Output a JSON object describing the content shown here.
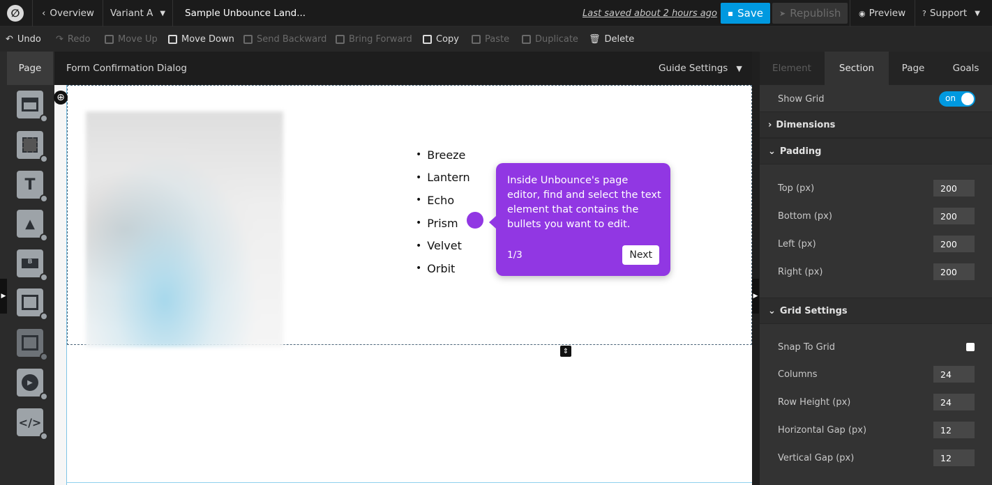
{
  "topbar": {
    "overview": "Overview",
    "variant": "Variant A",
    "page_name": "Sample Unbounce Land...",
    "last_saved": "Last saved  about 2 hours ago",
    "save": "Save",
    "republish": "Republish",
    "preview": "Preview",
    "support": "Support"
  },
  "toolbar": {
    "undo": "Undo",
    "redo": "Redo",
    "move_up": "Move Up",
    "move_down": "Move Down",
    "send_backward": "Send Backward",
    "bring_forward": "Bring Forward",
    "copy": "Copy",
    "paste": "Paste",
    "duplicate": "Duplicate",
    "delete": "Delete"
  },
  "left": {
    "page_tab": "Page",
    "title": "Form Confirmation Dialog",
    "guide_settings": "Guide Settings"
  },
  "canvas": {
    "bullets": [
      "Breeze",
      "Lantern",
      "Echo",
      "Prism",
      "Velvet",
      "Orbit"
    ]
  },
  "tooltip": {
    "text": "Inside Unbounce's page editor, find and select the text element that contains the bullets you want to edit.",
    "step": "1/3",
    "next": "Next"
  },
  "panel": {
    "tabs": [
      "Element",
      "Section",
      "Page",
      "Goals"
    ],
    "show_grid": "Show Grid",
    "show_grid_value": "on",
    "dimensions": "Dimensions",
    "padding": "Padding",
    "padding_fields": [
      {
        "label": "Top (px)",
        "value": "200"
      },
      {
        "label": "Bottom (px)",
        "value": "200"
      },
      {
        "label": "Left (px)",
        "value": "200"
      },
      {
        "label": "Right (px)",
        "value": "200"
      }
    ],
    "grid_settings": "Grid Settings",
    "snap_to_grid": "Snap To Grid",
    "grid_fields": [
      {
        "label": "Columns",
        "value": "24"
      },
      {
        "label": "Row Height (px)",
        "value": "24"
      },
      {
        "label": "Horizontal Gap (px)",
        "value": "12"
      },
      {
        "label": "Vertical Gap (px)",
        "value": "12"
      }
    ]
  },
  "colors": {
    "accent_blue": "#0099e0",
    "tooltip_purple": "#9137e3"
  }
}
